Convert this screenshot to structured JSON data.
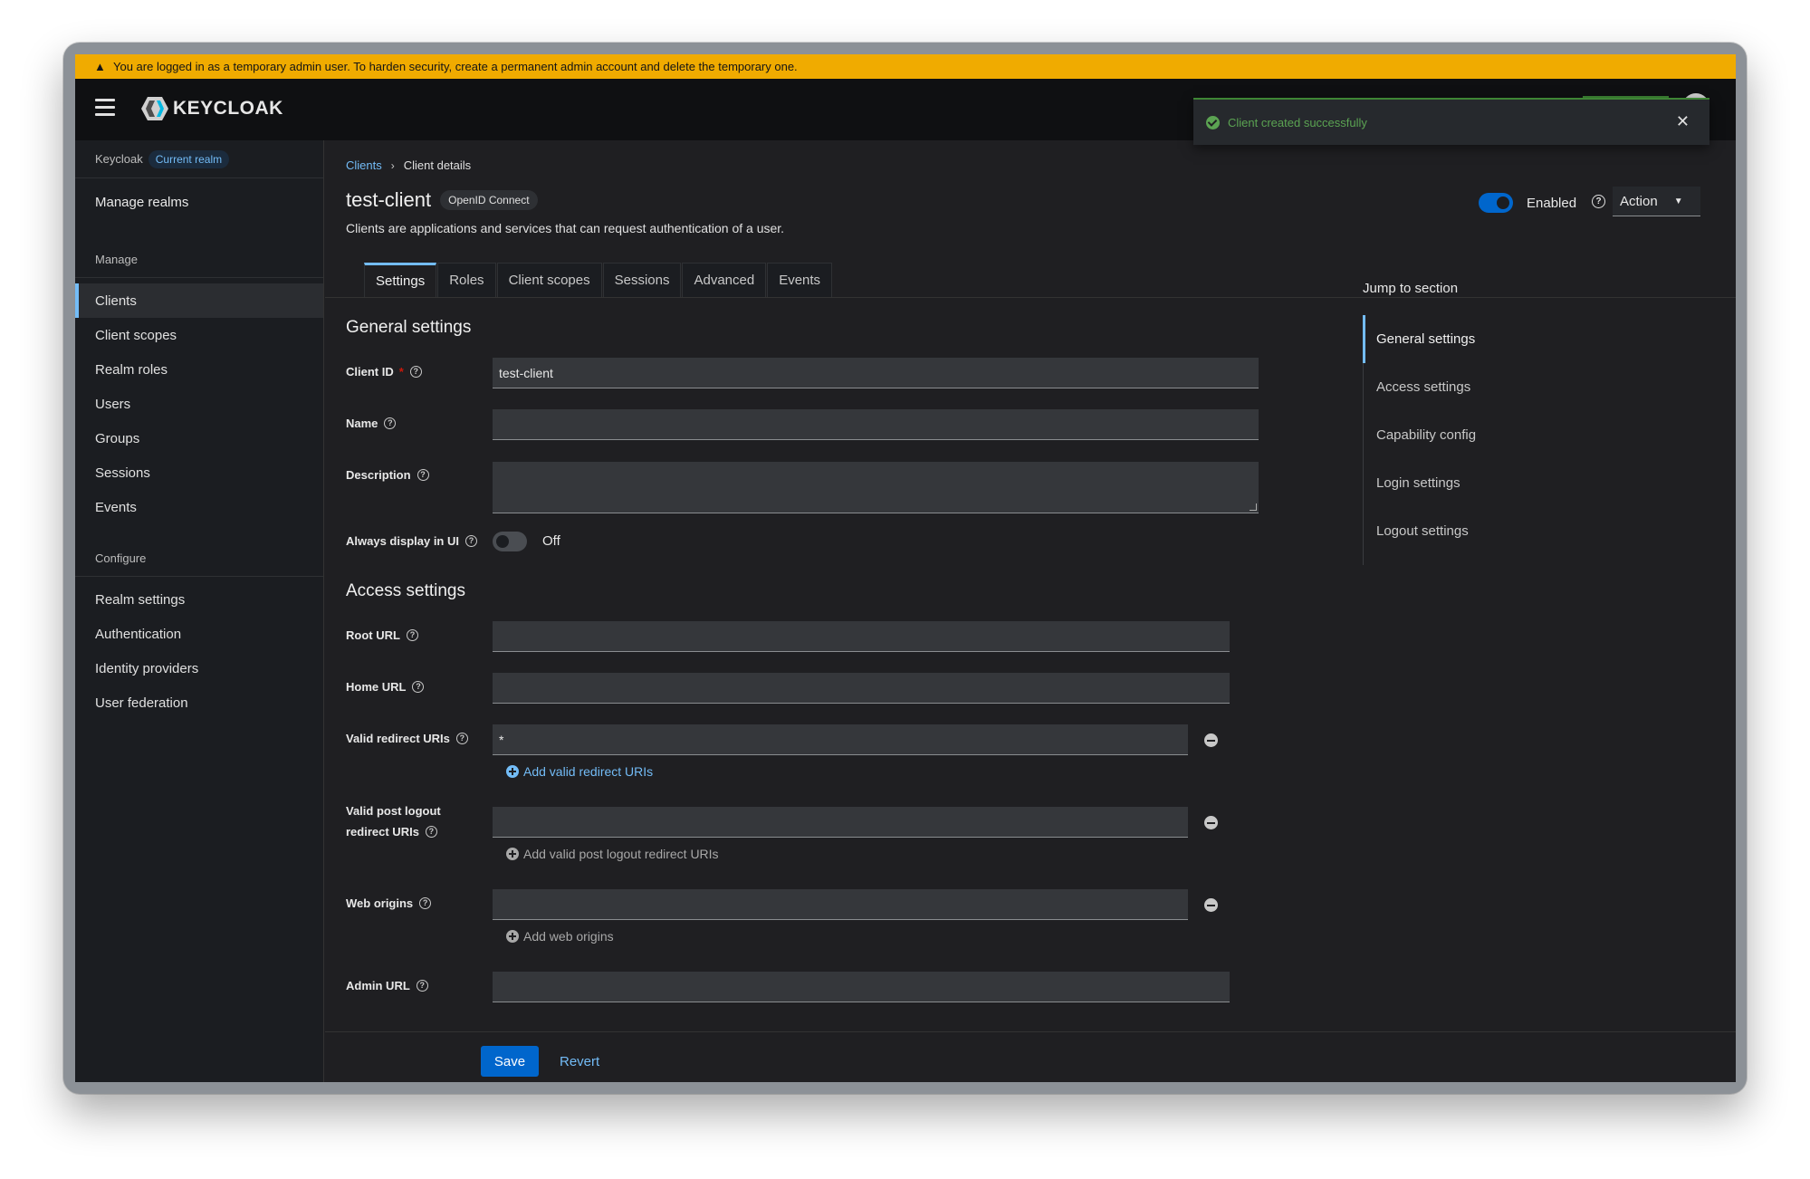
{
  "banner": {
    "text": "You are logged in as a temporary admin user. To harden security, create a permanent admin account and delete the temporary one."
  },
  "masthead": {
    "brand": "KEYCLOAK"
  },
  "toast": {
    "message": "Client created successfully"
  },
  "sidebar": {
    "realm_name": "Keycloak",
    "realm_badge": "Current realm",
    "manage_realms": "Manage realms",
    "manage_heading": "Manage",
    "manage_items": [
      {
        "label": "Clients"
      },
      {
        "label": "Client scopes"
      },
      {
        "label": "Realm roles"
      },
      {
        "label": "Users"
      },
      {
        "label": "Groups"
      },
      {
        "label": "Sessions"
      },
      {
        "label": "Events"
      }
    ],
    "configure_heading": "Configure",
    "configure_items": [
      {
        "label": "Realm settings"
      },
      {
        "label": "Authentication"
      },
      {
        "label": "Identity providers"
      },
      {
        "label": "User federation"
      }
    ]
  },
  "breadcrumb": {
    "parent": "Clients",
    "current": "Client details"
  },
  "header": {
    "title": "test-client",
    "protocol": "OpenID Connect",
    "description": "Clients are applications and services that can request authentication of a user.",
    "enabled_label": "Enabled",
    "action_label": "Action"
  },
  "tabs": [
    {
      "label": "Settings"
    },
    {
      "label": "Roles"
    },
    {
      "label": "Client scopes"
    },
    {
      "label": "Sessions"
    },
    {
      "label": "Advanced"
    },
    {
      "label": "Events"
    }
  ],
  "general": {
    "title": "General settings",
    "client_id_label": "Client ID",
    "client_id_value": "test-client",
    "name_label": "Name",
    "name_value": "",
    "description_label": "Description",
    "always_display_label": "Always display in UI",
    "always_display_state": "Off"
  },
  "access": {
    "title": "Access settings",
    "root_url_label": "Root URL",
    "home_url_label": "Home URL",
    "valid_redirect_label": "Valid redirect URIs",
    "valid_redirect_value": "*",
    "add_valid_redirect": "Add valid redirect URIs",
    "post_logout_label_1": "Valid post logout",
    "post_logout_label_2": "redirect URIs",
    "add_post_logout": "Add valid post logout redirect URIs",
    "web_origins_label": "Web origins",
    "add_web_origins": "Add web origins",
    "admin_url_label": "Admin URL"
  },
  "jump": {
    "title": "Jump to section",
    "items": [
      {
        "label": "General settings"
      },
      {
        "label": "Access settings"
      },
      {
        "label": "Capability config"
      },
      {
        "label": "Login settings"
      },
      {
        "label": "Logout settings"
      }
    ]
  },
  "footer": {
    "save": "Save",
    "revert": "Revert"
  }
}
